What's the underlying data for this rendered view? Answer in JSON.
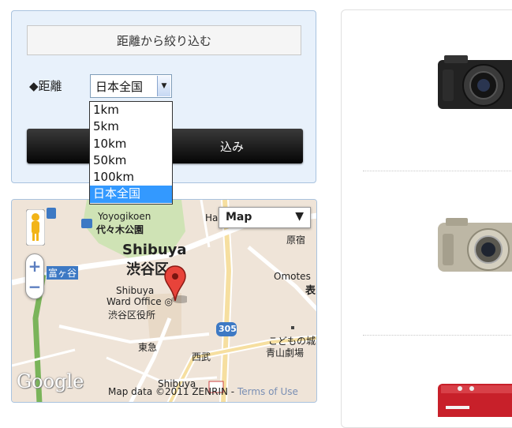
{
  "filter": {
    "header": "距離から絞り込む",
    "distance_label": "◆距離",
    "selected_value": "日本全国",
    "submit_label_visible": "込み",
    "options": [
      "1km",
      "5km",
      "10km",
      "50km",
      "100km",
      "日本全国"
    ],
    "selected_index": 5
  },
  "map": {
    "map_type": "Map",
    "map_type_arrow": "▼",
    "labels": {
      "yoyogikoen": "Yoyogikoen",
      "yoyogi_park": "代々木公園",
      "shibuya_en": "Shibuya",
      "shibuya_jp": "渋谷区",
      "ward_office_1": "Shibuya",
      "ward_office_2": "Ward Office ◎",
      "ward_office_jp": "渋谷区役所",
      "omotesando": "Omotes",
      "omotesando_jp": "表",
      "harajuku": "原宿",
      "ha": "Ha",
      "tomigaya": "富ヶ谷",
      "tokyu": "東急",
      "seibu": "西武",
      "kodomo": "こどもの城",
      "aoyama": "青山劇場",
      "route": "305",
      "shibuya_station": "Shibuya"
    },
    "google_logo": "Google",
    "attribution": "Map data ©2011 ZENRIN - ",
    "terms": "Terms of Use"
  },
  "products": [
    {
      "name": "black-compact-camera",
      "color": "#1e1e1e"
    },
    {
      "name": "silver-compact-camera",
      "color": "#b8b2a0"
    },
    {
      "name": "red-compact-camera",
      "color": "#c8202a"
    }
  ]
}
